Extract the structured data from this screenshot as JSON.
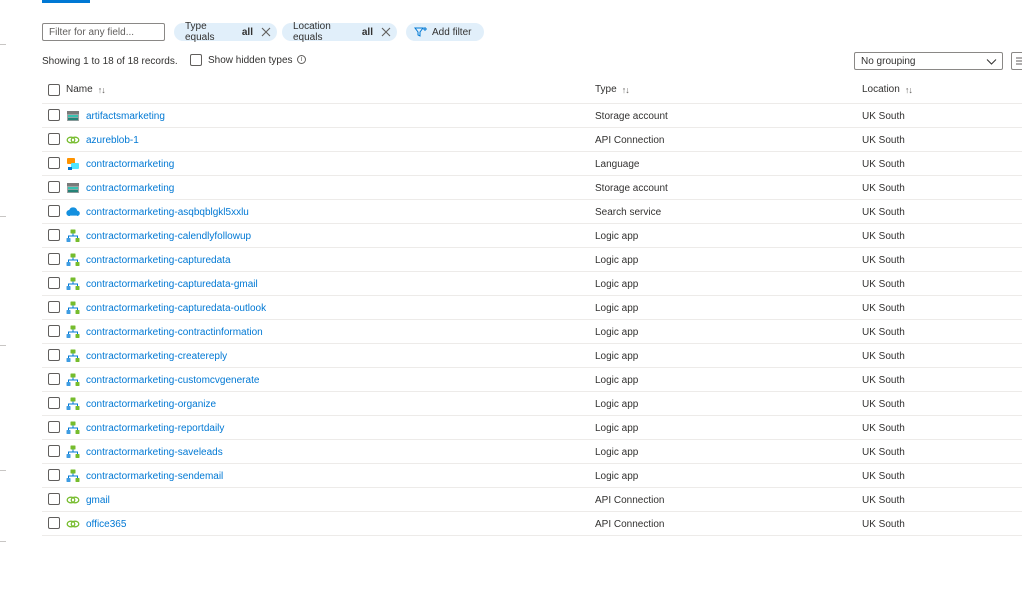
{
  "filter": {
    "placeholder": "Filter for any field..."
  },
  "pills": [
    {
      "label": "Type equals",
      "value": "all"
    },
    {
      "label": "Location equals",
      "value": "all"
    }
  ],
  "add_filter_label": "Add filter",
  "records_text": "Showing 1 to 18 of 18 records.",
  "show_hidden_label": "Show hidden types",
  "grouping": {
    "selected": "No grouping"
  },
  "columns": {
    "name": "Name",
    "type": "Type",
    "location": "Location"
  },
  "sort_glyph": "↑↓",
  "accent_color": "#0078d4",
  "rows": [
    {
      "name": "artifactsmarketing",
      "type": "Storage account",
      "location": "UK South",
      "icon": "storage-account-icon"
    },
    {
      "name": "azureblob-1",
      "type": "API Connection",
      "location": "UK South",
      "icon": "api-connection-icon"
    },
    {
      "name": "contractormarketing",
      "type": "Language",
      "location": "UK South",
      "icon": "language-icon"
    },
    {
      "name": "contractormarketing",
      "type": "Storage account",
      "location": "UK South",
      "icon": "storage-account-icon"
    },
    {
      "name": "contractormarketing-asqbqblgkl5xxlu",
      "type": "Search service",
      "location": "UK South",
      "icon": "search-service-icon"
    },
    {
      "name": "contractormarketing-calendlyfollowup",
      "type": "Logic app",
      "location": "UK South",
      "icon": "logic-app-icon"
    },
    {
      "name": "contractormarketing-capturedata",
      "type": "Logic app",
      "location": "UK South",
      "icon": "logic-app-icon"
    },
    {
      "name": "contractormarketing-capturedata-gmail",
      "type": "Logic app",
      "location": "UK South",
      "icon": "logic-app-icon"
    },
    {
      "name": "contractormarketing-capturedata-outlook",
      "type": "Logic app",
      "location": "UK South",
      "icon": "logic-app-icon"
    },
    {
      "name": "contractormarketing-contractinformation",
      "type": "Logic app",
      "location": "UK South",
      "icon": "logic-app-icon"
    },
    {
      "name": "contractormarketing-createreply",
      "type": "Logic app",
      "location": "UK South",
      "icon": "logic-app-icon"
    },
    {
      "name": "contractormarketing-customcvgenerate",
      "type": "Logic app",
      "location": "UK South",
      "icon": "logic-app-icon"
    },
    {
      "name": "contractormarketing-organize",
      "type": "Logic app",
      "location": "UK South",
      "icon": "logic-app-icon"
    },
    {
      "name": "contractormarketing-reportdaily",
      "type": "Logic app",
      "location": "UK South",
      "icon": "logic-app-icon"
    },
    {
      "name": "contractormarketing-saveleads",
      "type": "Logic app",
      "location": "UK South",
      "icon": "logic-app-icon"
    },
    {
      "name": "contractormarketing-sendemail",
      "type": "Logic app",
      "location": "UK South",
      "icon": "logic-app-icon"
    },
    {
      "name": "gmail",
      "type": "API Connection",
      "location": "UK South",
      "icon": "api-connection-icon"
    },
    {
      "name": "office365",
      "type": "API Connection",
      "location": "UK South",
      "icon": "api-connection-icon"
    }
  ]
}
